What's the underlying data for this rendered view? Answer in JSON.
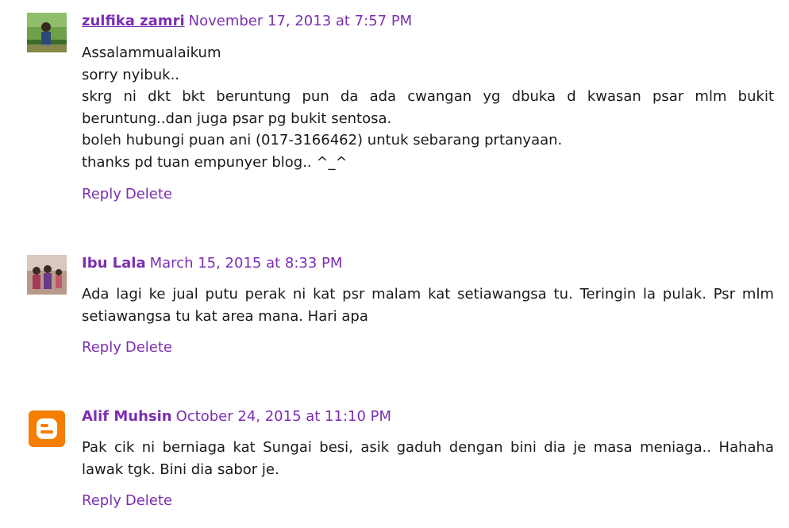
{
  "comments": [
    {
      "author": "zulfika zamri",
      "date": "November 17, 2013 at 7:57 PM",
      "avatar_icon": "profile-photo-outdoor",
      "lines": [
        "Assalammualaikum",
        "sorry nyibuk..",
        "skrg ni dkt bkt beruntung pun da ada cwangan yg dbuka d kwasan psar mlm bukit beruntung..dan juga psar pg bukit sentosa.",
        "boleh hubungi puan ani (017-3166462) untuk sebarang prtanyaan.",
        "thanks pd tuan empunyer blog.. ^_^"
      ],
      "reply_label": "Reply",
      "delete_label": "Delete"
    },
    {
      "author": "Ibu Lala",
      "date": "March 15, 2015 at 8:33 PM",
      "avatar_icon": "profile-photo-family",
      "lines": [
        "Ada lagi ke jual putu perak ni kat psr malam kat setiawangsa tu. Teringin la pulak. Psr mlm setiawangsa tu kat area mana. Hari apa"
      ],
      "reply_label": "Reply",
      "delete_label": "Delete"
    },
    {
      "author": "Alif Muhsin",
      "date": "October 24, 2015 at 11:10 PM",
      "avatar_icon": "blogger-logo-icon",
      "lines": [
        "Pak cik ni berniaga kat Sungai besi, asik gaduh dengan bini dia je masa meniaga.. Hahaha lawak tgk. Bini dia sabor je."
      ],
      "reply_label": "Reply",
      "delete_label": "Delete"
    }
  ],
  "colors": {
    "link": "#7b2fb0",
    "text": "#1a1a1a",
    "blogger_orange": "#f57d00"
  }
}
